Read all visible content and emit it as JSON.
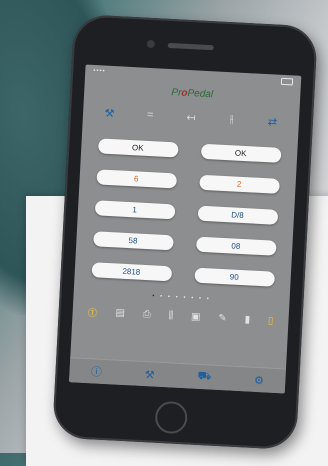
{
  "app": {
    "logo_prefix": "Pr",
    "logo_mid": "o",
    "logo_suffix": "Pedal"
  },
  "status_bar": {
    "left": "•••• ",
    "right": ""
  },
  "toolbar": [
    {
      "icon": "hammer-icon",
      "glyph": "⚒"
    },
    {
      "icon": "equals-icon",
      "glyph": "="
    },
    {
      "icon": "arrow-left-icon",
      "glyph": "↤"
    },
    {
      "icon": "tuning-icon",
      "glyph": "⫲"
    },
    {
      "icon": "swap-icon",
      "glyph": "⇄"
    }
  ],
  "fields": [
    {
      "value": "OK",
      "style": ""
    },
    {
      "value": "OK",
      "style": ""
    },
    {
      "value": "6",
      "style": "orange"
    },
    {
      "value": "2",
      "style": "orange"
    },
    {
      "value": "1",
      "style": "blue"
    },
    {
      "value": "D/8",
      "style": "blue"
    },
    {
      "value": "58",
      "style": "blue"
    },
    {
      "value": "08",
      "style": "blue"
    },
    {
      "value": "2818",
      "style": "blue"
    },
    {
      "value": "90",
      "style": "blue"
    }
  ],
  "page_dots": {
    "active": "•",
    "inactive": "• • • • • • •"
  },
  "tray": [
    {
      "icon": "warning-icon",
      "glyph": "⓵",
      "style": "warn"
    },
    {
      "icon": "chart-icon",
      "glyph": "▤"
    },
    {
      "icon": "printer-icon",
      "glyph": "⎙"
    },
    {
      "icon": "columns-icon",
      "glyph": "⫼"
    },
    {
      "icon": "image-icon",
      "glyph": "▣"
    },
    {
      "icon": "pen-icon",
      "glyph": "✎"
    },
    {
      "icon": "bookmark-icon",
      "glyph": "▮"
    },
    {
      "icon": "battery-icon",
      "glyph": "▯",
      "style": "warn"
    }
  ],
  "tabbar": [
    {
      "icon": "info-icon",
      "glyph": "ⓘ"
    },
    {
      "icon": "tools-icon",
      "glyph": "⚒"
    },
    {
      "icon": "car-icon",
      "glyph": "⛟"
    },
    {
      "icon": "gear-icon",
      "glyph": "⚙"
    }
  ]
}
